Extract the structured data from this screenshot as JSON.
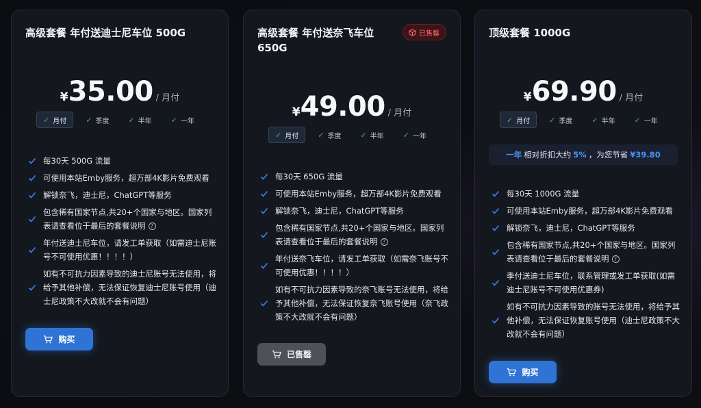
{
  "plans": [
    {
      "title": "高级套餐 年付送迪士尼车位 500G",
      "price": {
        "currency": "¥",
        "amount": "35.00",
        "per": "/ 月付"
      },
      "periods": [
        "月付",
        "季度",
        "半年",
        "一年"
      ],
      "active_period": "月付",
      "features": [
        "每30天 500G 流量",
        "可使用本站Emby服务，超万部4K影片免费观看",
        "解锁奈飞，迪士尼，ChatGPT等服务",
        "包含稀有国家节点,共20+个国家与地区。国家列表请查看位于最后的套餐说明",
        "年付送迪士尼车位，请发工单获取（如需迪士尼账号不可使用优惠！！！！）",
        "如有不可抗力因素导致的迪士尼账号无法使用，将给予其他补偿，无法保证恢复迪士尼账号使用（迪士尼政策不大改就不会有问题）"
      ],
      "button": "购买",
      "button_state": "buy"
    },
    {
      "title": "高级套餐 年付送奈飞车位 650G",
      "badge": "已售罄",
      "price": {
        "currency": "¥",
        "amount": "49.00",
        "per": "/ 月付"
      },
      "periods": [
        "月付",
        "季度",
        "半年",
        "一年"
      ],
      "active_period": "月付",
      "features": [
        "每30天 650G 流量",
        "可使用本站Emby服务，超万部4K影片免费观看",
        "解锁奈飞，迪士尼，ChatGPT等服务",
        "包含稀有国家节点,共20+个国家与地区。国家列表请查看位于最后的套餐说明",
        "年付送奈飞车位，请发工单获取（如需奈飞账号不可使用优惠！！！！）",
        "如有不可抗力因素导致的奈飞账号无法使用，将给予其他补偿，无法保证恢复奈飞账号使用（奈飞政策不大改就不会有问题）"
      ],
      "button": "已售罄",
      "button_state": "sold"
    },
    {
      "title": "顶级套餐 1000G",
      "price": {
        "currency": "¥",
        "amount": "69.90",
        "per": "/ 月付"
      },
      "periods": [
        "月付",
        "季度",
        "半年",
        "一年"
      ],
      "active_period": "月付",
      "savings": {
        "period": "一年",
        "text1": "相对折扣大约",
        "pct": "5%",
        "text2": "，为您节省",
        "amount": "¥39.80"
      },
      "features": [
        "每30天 1000G 流量",
        "可使用本站Emby服务，超万部4K影片免费观看",
        "解锁奈飞，迪士尼，ChatGPT等服务",
        "包含稀有国家节点,共20+个国家与地区。国家列表请查看位于最后的套餐说明",
        "季付送迪士尼车位，联系管理或发工单获取(如需迪士尼账号不可使用优惠券)",
        "如有不可抗力因素导致的账号无法使用，将给予其他补偿，无法保证恢复账号使用（迪士尼政策不大改就不会有问题）"
      ],
      "button": "购买",
      "button_state": "buy"
    }
  ],
  "colors": {
    "accent": "#2f73d4",
    "check": "#3b82f6",
    "period_check": "#4caf6e",
    "sold_badge": "#ff6b6b",
    "sold_button": "#4e5156"
  },
  "icons": {
    "feature": "check-icon",
    "help": "question-circle-icon",
    "cart": "cart-icon",
    "badge": "box-icon"
  }
}
